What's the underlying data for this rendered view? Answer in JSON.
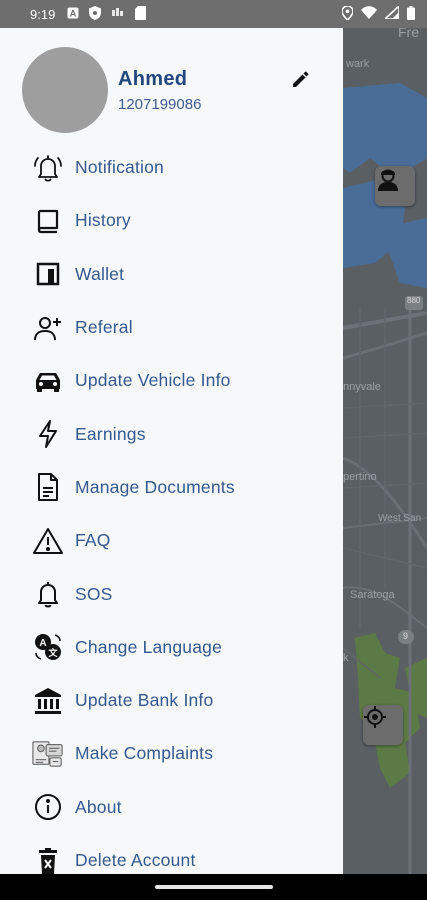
{
  "status_bar": {
    "time": "9:19",
    "icons": [
      "notification-a-icon",
      "shield-icon",
      "sim-icon",
      "sd-card-icon"
    ],
    "right_icons": [
      "location-icon",
      "wifi-icon",
      "signal-icon",
      "battery-icon"
    ]
  },
  "map": {
    "labels": [
      "Fre",
      "wark",
      "nnyvale",
      "pertino",
      "West San",
      "Saratoga",
      "k"
    ],
    "route_shields": [
      "880",
      "9"
    ],
    "colors": {
      "water": "#4a6d98",
      "park": "#5c7a45",
      "land": "#5a5f63"
    }
  },
  "profile": {
    "name": "Ahmed",
    "phone": "1207199086"
  },
  "menu": [
    {
      "label": "Notification",
      "icon": "bell-ring-icon"
    },
    {
      "label": "History",
      "icon": "book-icon"
    },
    {
      "label": "Wallet",
      "icon": "wallet-icon"
    },
    {
      "label": "Referal",
      "icon": "person-add-icon"
    },
    {
      "label": "Update Vehicle Info",
      "icon": "car-icon"
    },
    {
      "label": "Earnings",
      "icon": "lightning-icon"
    },
    {
      "label": "Manage Documents",
      "icon": "document-icon"
    },
    {
      "label": "FAQ",
      "icon": "warning-icon"
    },
    {
      "label": "SOS",
      "icon": "bell-icon"
    },
    {
      "label": "Change Language",
      "icon": "translate-icon"
    },
    {
      "label": "Update Bank Info",
      "icon": "bank-icon"
    },
    {
      "label": "Make Complaints",
      "icon": "complaint-icon"
    },
    {
      "label": "About",
      "icon": "info-icon"
    },
    {
      "label": "Delete Account",
      "icon": "delete-icon"
    }
  ],
  "colors": {
    "accent": "#34598f",
    "name": "#22477f",
    "drawer_bg": "#f7f8fa",
    "status_bar": "#6e6e6e"
  }
}
